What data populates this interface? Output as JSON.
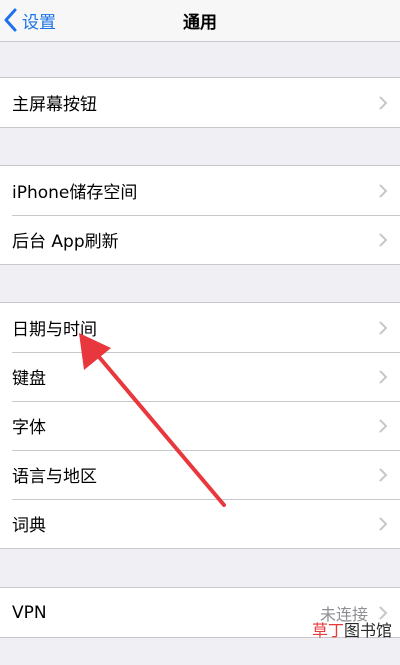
{
  "nav": {
    "back_label": "设置",
    "title": "通用"
  },
  "groups": [
    {
      "rows": [
        {
          "label": "主屏幕按钮"
        }
      ]
    },
    {
      "rows": [
        {
          "label": "iPhone储存空间"
        },
        {
          "label": "后台 App刷新"
        }
      ]
    },
    {
      "rows": [
        {
          "label": "日期与时间"
        },
        {
          "label": "键盘"
        },
        {
          "label": "字体"
        },
        {
          "label": "语言与地区"
        },
        {
          "label": "词典"
        }
      ]
    },
    {
      "rows": [
        {
          "label": "VPN",
          "value": "未连接"
        }
      ]
    }
  ],
  "watermark": {
    "part1": "草丁",
    "part2": "图书馆"
  },
  "colors": {
    "background": "#efeff4",
    "accent": "#1a73e8",
    "arrow": "#e8383d",
    "secondary_text": "#8e8e93"
  },
  "icons": {
    "back": "chevron-left-icon",
    "disclosure": "chevron-right-icon"
  }
}
